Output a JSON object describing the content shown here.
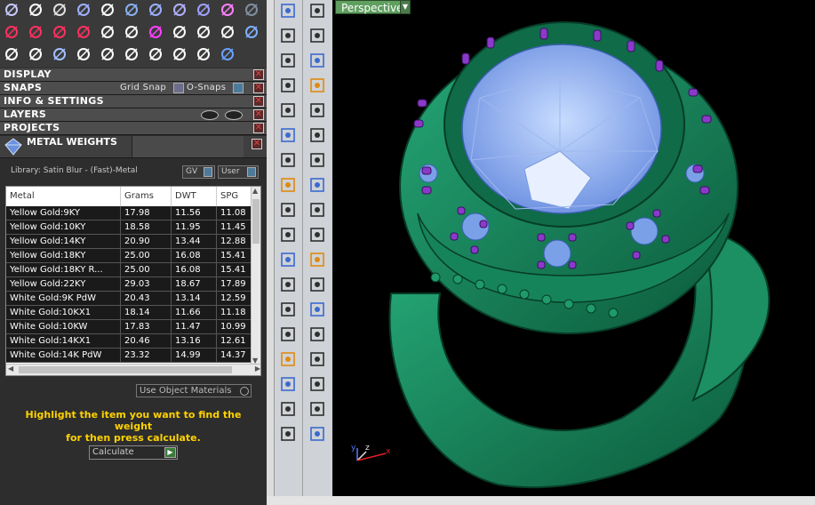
{
  "toolbar_icons": [
    "arc-icon",
    "curve-icon",
    "circle-icon",
    "ellipse-icon",
    "node-icon",
    "shape-icon",
    "blob-icon",
    "shield-icon",
    "lock-icon",
    "s-icon",
    "panel-icon",
    "cross-add-icon",
    "cross-add2-icon",
    "minus-add-icon",
    "arc-add-icon",
    "link-icon",
    "chain-icon",
    "dots-icon",
    "pen-icon",
    "tool-icon",
    "sphere-icon",
    "gear-icon",
    "curve2-icon",
    "curve3-icon",
    "pattern-icon",
    "move-icon",
    "flip-icon",
    "star-icon",
    "chain2-icon",
    "chain3-icon",
    "scissors-icon",
    "ring-icon"
  ],
  "panels": {
    "display": "DISPLAY",
    "snaps": "SNAPS",
    "snaps_grid": "Grid Snap",
    "snaps_o": "O-Snaps",
    "info": "INFO & SETTINGS",
    "layers": "LAYERS",
    "projects": "PROJECTS"
  },
  "metal_weights": {
    "title": "METAL WEIGHTS",
    "library": "Library: Satin Blur - (Fast)-Metal",
    "gv_label": "GV",
    "user_label": "User",
    "columns": [
      "Metal",
      "Grams",
      "DWT",
      "SPG"
    ],
    "rows": [
      [
        "Yellow Gold:9KY",
        "17.98",
        "11.56",
        "11.08"
      ],
      [
        "Yellow Gold:10KY",
        "18.58",
        "11.95",
        "11.45"
      ],
      [
        "Yellow Gold:14KY",
        "20.90",
        "13.44",
        "12.88"
      ],
      [
        "Yellow Gold:18KY",
        "25.00",
        "16.08",
        "15.41"
      ],
      [
        "Yellow Gold:18KY R...",
        "25.00",
        "16.08",
        "15.41"
      ],
      [
        "Yellow Gold:22KY",
        "29.03",
        "18.67",
        "17.89"
      ],
      [
        "White Gold:9K PdW",
        "20.43",
        "13.14",
        "12.59"
      ],
      [
        "White Gold:10KX1",
        "18.14",
        "11.66",
        "11.18"
      ],
      [
        "White Gold:10KW",
        "17.83",
        "11.47",
        "10.99"
      ],
      [
        "White Gold:14KX1",
        "20.46",
        "13.16",
        "12.61"
      ],
      [
        "White Gold:14K PdW",
        "23.32",
        "14.99",
        "14.37"
      ]
    ],
    "use_object_materials": "Use Object Materials",
    "message_line1": "Highlight the item you want to find the weight",
    "message_line2": "for then press calculate.",
    "calculate": "Calculate"
  },
  "viewport": {
    "label": "Perspective",
    "axis_x": "x",
    "axis_y": "y",
    "axis_z": "z"
  },
  "colors": {
    "ring": "#1b8a60",
    "ring_dark": "#0d5a3c",
    "gem": "#8ab0f0",
    "prong": "#8a3ac8",
    "highlight_text": "#ffd200"
  },
  "vertical_tools": [
    "cursor-icon",
    "select-rect-icon",
    "polyline-icon",
    "node-edit-icon",
    "circle-draw-icon",
    "ellipse-draw-icon",
    "arc-draw-icon",
    "rect-draw-icon",
    "polygon-icon",
    "fillet-icon",
    "grid-pts-icon",
    "bend-icon",
    "box-icon",
    "sphere-solid-icon",
    "cylinder-icon",
    "surface-icon",
    "gear-tool-icon",
    "gem-tool-icon",
    "cut-icon",
    "plane-icon",
    "boolean-icon",
    "scatter-icon",
    "curve-on-surface-icon",
    "offset-icon",
    "text-icon",
    "project-icon",
    "array-icon",
    "deform-icon",
    "solid-box-icon",
    "pavé-icon",
    "matrix-icon",
    "measure-icon",
    "book-icon",
    "check-icon",
    "pyramid-icon",
    "cone-icon"
  ]
}
